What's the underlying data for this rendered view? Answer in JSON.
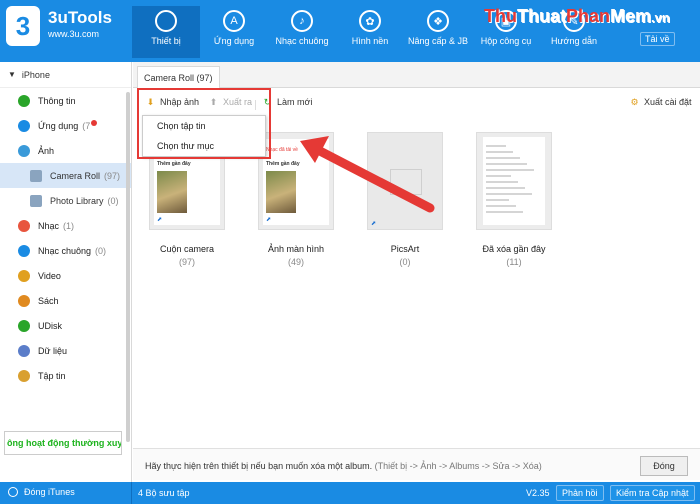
{
  "app": {
    "name": "3uTools",
    "url": "www.3u.com",
    "logo_char": "3"
  },
  "nav": [
    {
      "label": "Thiết bị",
      "icon": "apple-icon",
      "glyph": "",
      "active": true
    },
    {
      "label": "Ứng dụng",
      "icon": "app-store-icon",
      "glyph": "A",
      "active": false
    },
    {
      "label": "Nhạc chuông",
      "icon": "bell-icon",
      "glyph": "♪",
      "active": false
    },
    {
      "label": "Hình nền",
      "icon": "flower-icon",
      "glyph": "✿",
      "active": false
    },
    {
      "label": "Nâng cấp & JB",
      "icon": "dropbox-icon",
      "glyph": "❖",
      "active": false
    },
    {
      "label": "Hộp công cụ",
      "icon": "toolbox-icon",
      "glyph": "▣",
      "active": false
    },
    {
      "label": "Hướng dẫn",
      "icon": "guide-icon",
      "glyph": "✎",
      "active": false
    }
  ],
  "watermark": {
    "p1": "Thu",
    "p2": "Thuat",
    "p3": "Phan",
    "p4": "Mem",
    "p5": ".vn"
  },
  "download_label": "Tải về",
  "sidebar": {
    "device": "iPhone",
    "items": [
      {
        "label": "Thông tin",
        "icon": "info-icon",
        "color": "#2aa52a",
        "count": "",
        "dot": false,
        "sub": false,
        "selected": false
      },
      {
        "label": "Ứng dụng",
        "icon": "app-icon",
        "color": "#1a8be3",
        "count": "(7",
        "dot": true,
        "sub": false,
        "selected": false
      },
      {
        "label": "Ảnh",
        "icon": "photo-icon",
        "color": "#3a9ad9",
        "count": "",
        "dot": false,
        "sub": false,
        "selected": false
      },
      {
        "label": "Camera Roll",
        "icon": "folder-icon",
        "color": "#8aa4bf",
        "count": "(97)",
        "dot": false,
        "sub": true,
        "selected": true
      },
      {
        "label": "Photo Library",
        "icon": "folder-icon",
        "color": "#8aa4bf",
        "count": "(0)",
        "dot": false,
        "sub": true,
        "selected": false
      },
      {
        "label": "Nhạc",
        "icon": "music-icon",
        "color": "#e8553e",
        "count": "(1)",
        "dot": false,
        "sub": false,
        "selected": false
      },
      {
        "label": "Nhạc chuông",
        "icon": "bell-icon",
        "color": "#1a8be3",
        "count": "(0)",
        "dot": false,
        "sub": false,
        "selected": false
      },
      {
        "label": "Video",
        "icon": "video-icon",
        "color": "#e0a020",
        "count": "",
        "dot": false,
        "sub": false,
        "selected": false
      },
      {
        "label": "Sách",
        "icon": "book-icon",
        "color": "#e08a20",
        "count": "",
        "dot": false,
        "sub": false,
        "selected": false
      },
      {
        "label": "UDisk",
        "icon": "udisk-icon",
        "color": "#2aa52a",
        "count": "",
        "dot": false,
        "sub": false,
        "selected": false
      },
      {
        "label": "Dữ liệu",
        "icon": "data-icon",
        "color": "#5b7dc9",
        "count": "",
        "dot": false,
        "sub": false,
        "selected": false
      },
      {
        "label": "Tập tin",
        "icon": "file-icon",
        "color": "#d9a030",
        "count": "",
        "dot": false,
        "sub": false,
        "selected": false
      }
    ],
    "status_text": "ông hoạt động thường xuyê"
  },
  "tab": {
    "label": "Camera Roll (97)"
  },
  "toolbar": {
    "import_label": "Nhập ảnh",
    "export_label": "Xuất ra",
    "refresh_label": "Làm mới",
    "settings_label": "Xuất cài đặt"
  },
  "dropdown": {
    "items": [
      "Chọn tập tin",
      "Chọn thư mục"
    ]
  },
  "albums": [
    {
      "title": "Cuộn camera",
      "count": "(97)",
      "kind": "preview"
    },
    {
      "title": "Ảnh màn hình",
      "count": "(49)",
      "kind": "preview"
    },
    {
      "title": "PicsArt",
      "count": "(0)",
      "kind": "empty"
    },
    {
      "title": "Đã xóa gần đây",
      "count": "(11)",
      "kind": "phone"
    }
  ],
  "preview_text": {
    "line1": "Nhạc đã tải về",
    "line2": "Thêm gần đây"
  },
  "info": {
    "text": "Hãy thực hiện trên thiết bị nếu bạn muốn xóa một album.",
    "hint": "(Thiết bị -> Ảnh -> Albums -> Sửa -> Xóa)",
    "close_label": "Đóng"
  },
  "statusbar": {
    "itunes_label": "Đóng iTunes",
    "collections": "4 Bộ sưu tập",
    "version": "V2.35",
    "feedback_label": "Phản hồi",
    "update_label": "Kiểm tra Cập nhật"
  }
}
